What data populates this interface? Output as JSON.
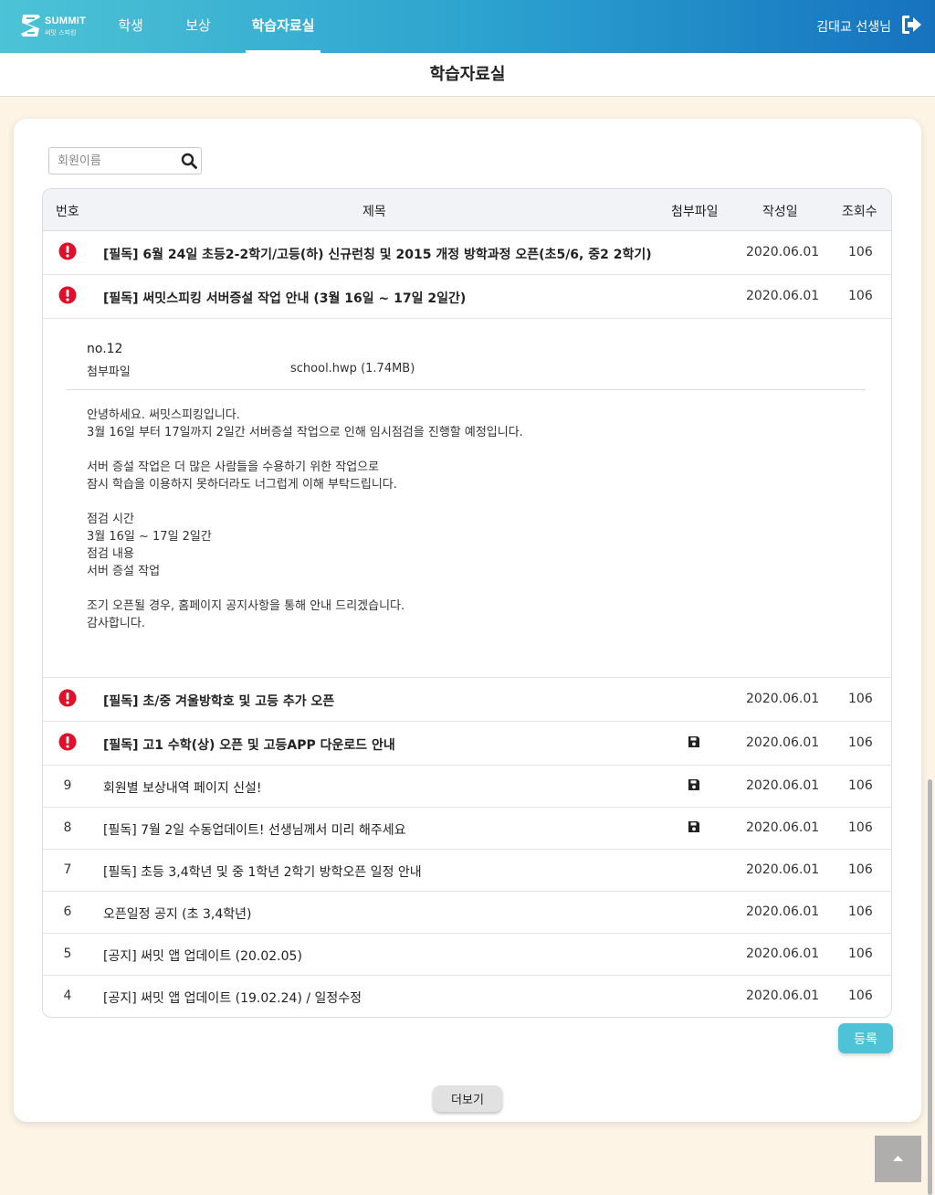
{
  "brand": {
    "name": "SUMMIT",
    "sub": "써밋 스피킹"
  },
  "nav": {
    "items": [
      {
        "label": "학생"
      },
      {
        "label": "보상"
      },
      {
        "label": "학습자료실"
      }
    ],
    "active": "학습자료실",
    "user": "김대교 선생님",
    "logout_icon": "sign-out-icon"
  },
  "page": {
    "title": "학습자료실"
  },
  "search": {
    "placeholder": "회원이름",
    "value": "",
    "icon": "search-icon"
  },
  "table": {
    "headers": {
      "num": "번호",
      "title": "제목",
      "file": "첨부파일",
      "date": "작성일",
      "views": "조회수"
    },
    "rows": [
      {
        "num": "",
        "notice": true,
        "title": "[필독] 6월 24일 초등2-2학기/고등(하) 신규런칭 및 2015 개정 방학과정 오픈(초5/6, 중2 2학기)",
        "file": false,
        "date": "2020.06.01",
        "views": "106"
      },
      {
        "num": "",
        "notice": true,
        "title": "[필독] 써밋스피킹 서버증설 작업 안내 (3월 16일 ~ 17일 2일간)",
        "file": false,
        "date": "2020.06.01",
        "views": "106"
      },
      {
        "num": "",
        "notice": true,
        "title": "[필독] 초/중 겨울방학호 및 고등 추가 오픈",
        "file": false,
        "date": "2020.06.01",
        "views": "106"
      },
      {
        "num": "",
        "notice": true,
        "title": "[필독] 고1 수학(상) 오픈 및 고등APP 다운로드 안내",
        "file": true,
        "date": "2020.06.01",
        "views": "106"
      },
      {
        "num": "9",
        "notice": false,
        "title": "회원별 보상내역 페이지 신설!",
        "file": true,
        "date": "2020.06.01",
        "views": "106"
      },
      {
        "num": "8",
        "notice": false,
        "title": "[필독] 7월 2일 수동업데이트! 선생님께서 미리 해주세요",
        "file": true,
        "date": "2020.06.01",
        "views": "106"
      },
      {
        "num": "7",
        "notice": false,
        "title": "[필독] 초등 3,4학년 및 중 1학년 2학기 방학오픈 일정 안내",
        "file": false,
        "date": "2020.06.01",
        "views": "106"
      },
      {
        "num": "6",
        "notice": false,
        "title": "오픈일정 공지 (초 3,4학년)",
        "file": false,
        "date": "2020.06.01",
        "views": "106"
      },
      {
        "num": "5",
        "notice": false,
        "title": "[공지] 써밋 앱 업데이트 (20.02.05)",
        "file": false,
        "date": "2020.06.01",
        "views": "106"
      },
      {
        "num": "4",
        "notice": false,
        "title": "[공지] 써밋 앱 업데이트 (19.02.24) / 일정수정",
        "file": false,
        "date": "2020.06.01",
        "views": "106"
      }
    ]
  },
  "detail": {
    "no": "no.12",
    "file_label": "첨부파일",
    "file_name": "school.hwp (1.74MB)",
    "body": [
      "안녕하세요. 써밋스피킹입니다.",
      "3월 16일 부터 17일까지 2일간 서버증설 작업으로 인해 임시점검을 진행할 예정입니다.",
      "",
      "서버 증설 작업은 더 많은 사람들을 수용하기 위한 작업으로",
      "잠시 학습을 이용하지 못하더라도 너그럽게 이해 부탁드립니다.",
      "",
      "점검 시간",
      "3월 16일 ~ 17일 2일간",
      "점검 내용",
      "서버 증설 작업",
      "",
      "조기 오픈될 경우, 홈페이지 공지사항을 통해 안내 드리겠습니다.",
      "감사합니다."
    ]
  },
  "buttons": {
    "register": "등록",
    "more": "더보기"
  },
  "colors": {
    "accent": "#4ec3d8",
    "alert": "#e0102a",
    "background": "#fdf4e6"
  }
}
